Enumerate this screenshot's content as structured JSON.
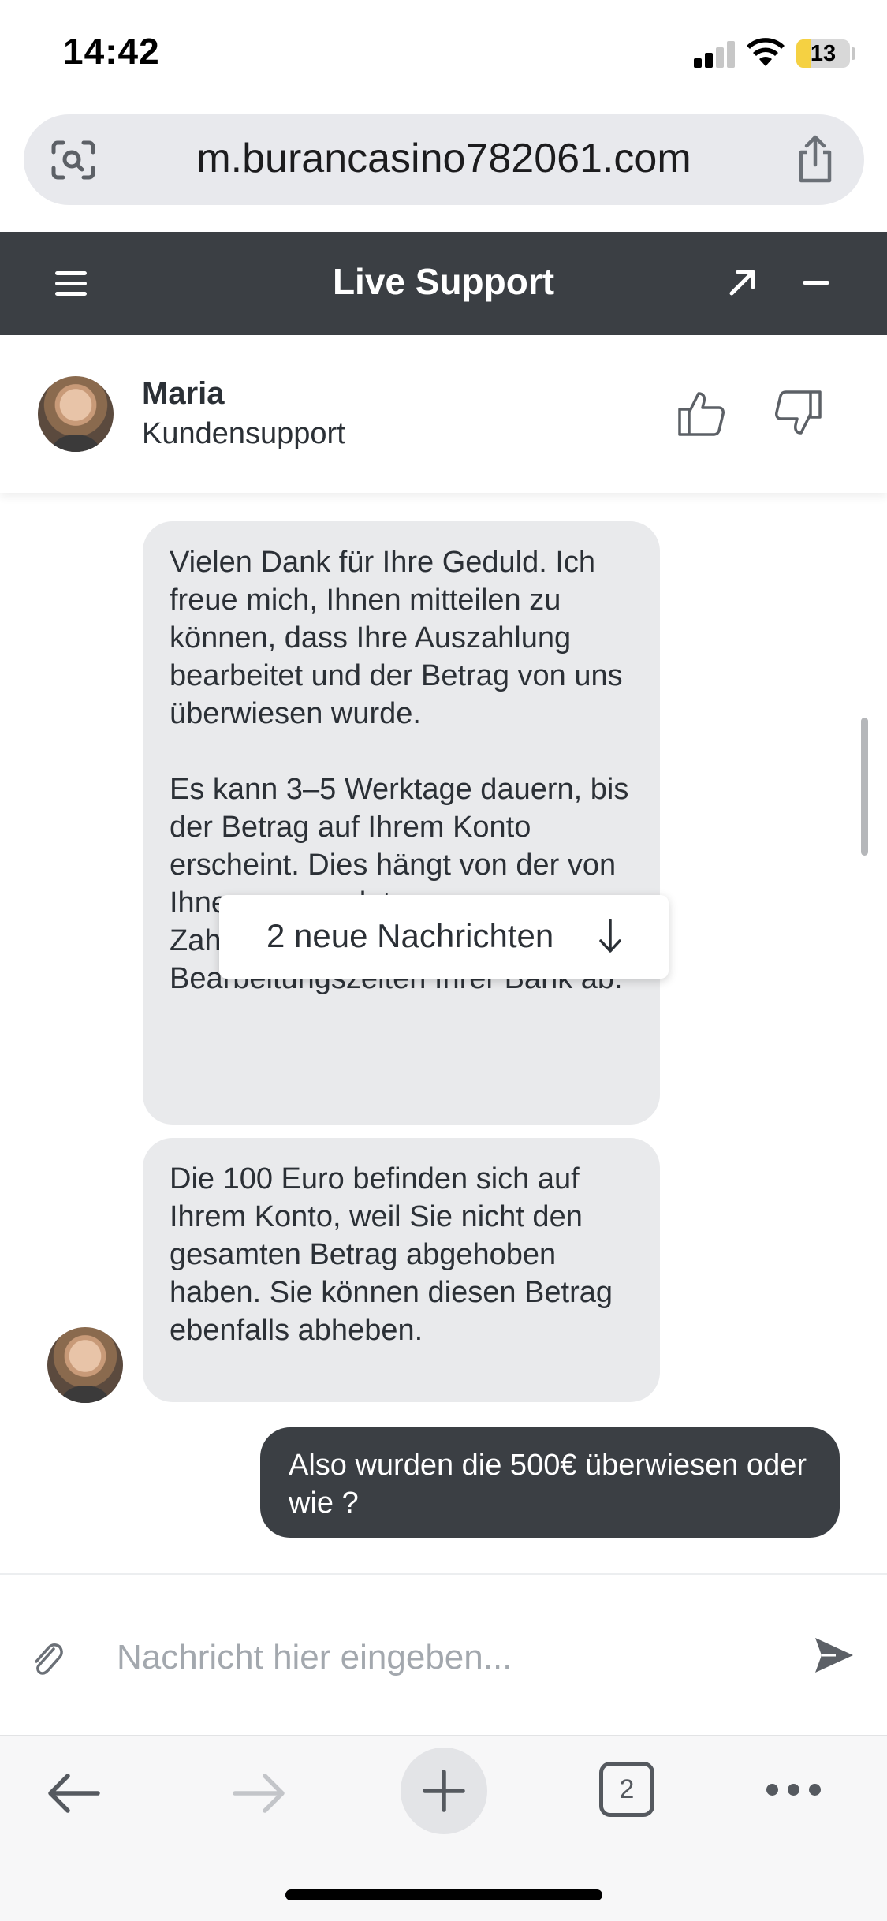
{
  "status_bar": {
    "time": "14:42",
    "battery": "13"
  },
  "browser": {
    "url": "m.burancasino782061.com",
    "tab_count": "2"
  },
  "chat": {
    "title": "Live Support",
    "agent": {
      "name": "Maria",
      "role": "Kundensupport"
    },
    "messages": [
      {
        "from": "agent",
        "text": "Vielen Dank für Ihre Geduld. Ich freue mich, Ihnen mitteilen zu können, dass Ihre Auszahlung bearbeitet und der Betrag von uns überwiesen wurde.\n\nEs kann 3–5 Werktage dauern, bis der Betrag auf Ihrem Konto erscheint. Dies hängt von der von Ihnen verwendeten Zahlungsmethode und den Bearbeitungszeiten Ihrer Bank ab."
      },
      {
        "from": "agent",
        "text": "Die 100 Euro befinden sich auf Ihrem Konto, weil Sie nicht den gesamten Betrag abgehoben haben. Sie können diesen Betrag ebenfalls abheben."
      },
      {
        "from": "user",
        "text": "Also wurden die 500€ überwiesen oder wie ?"
      }
    ],
    "new_messages_label": "2 neue Nachrichten",
    "input": {
      "placeholder": "Nachricht hier eingeben...",
      "value": ""
    }
  }
}
